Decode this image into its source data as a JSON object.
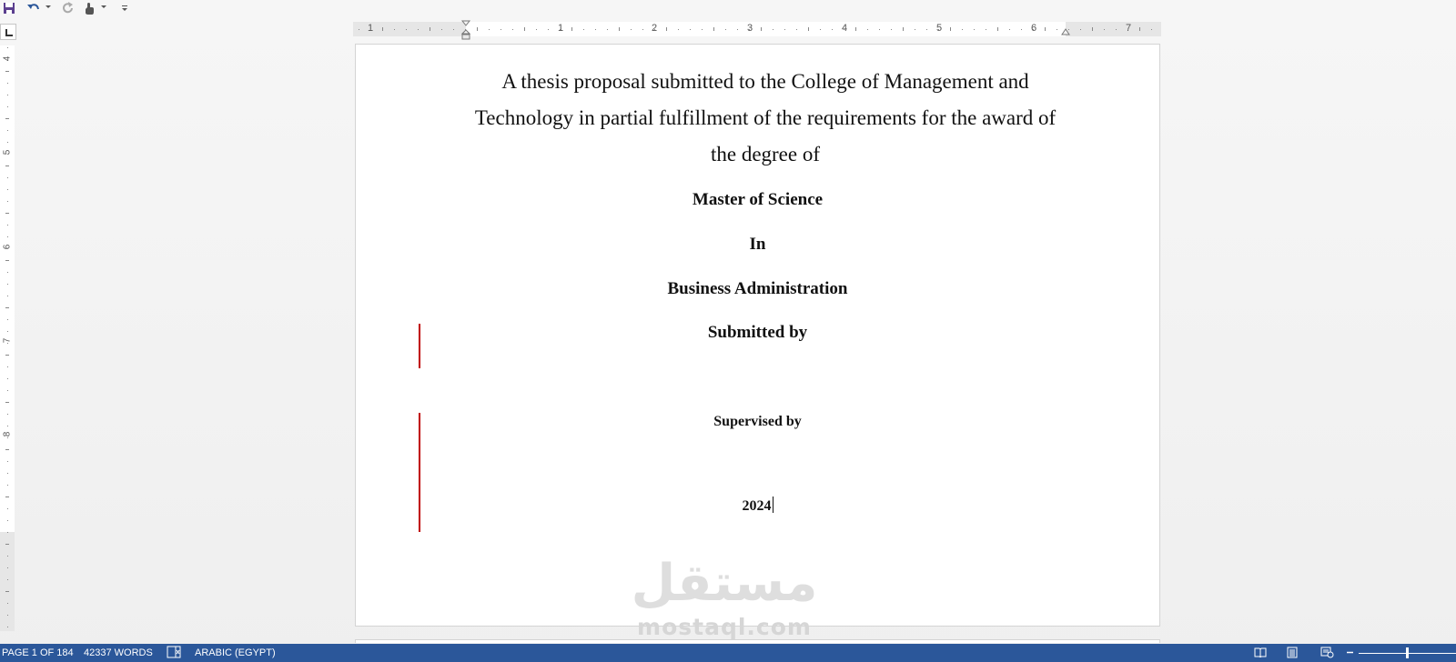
{
  "toolbar": {
    "save_icon": "save-icon",
    "undo_icon": "undo-icon",
    "redo_icon": "redo-icon",
    "touch_mode_icon": "touch-mode-icon",
    "customize_icon": "customize-toolbar-icon"
  },
  "ruler": {
    "horizontal_numbers": [
      "1",
      "1",
      "2",
      "3",
      "4",
      "5",
      "6",
      "7"
    ],
    "vertical_numbers": [
      "4",
      "5",
      "6",
      "7",
      "8"
    ]
  },
  "document": {
    "intro_line_1": "A thesis proposal submitted to the College of Management and",
    "intro_line_2": "Technology in partial fulfillment of the requirements for the award of",
    "intro_line_3": "the degree of",
    "degree": "Master of Science",
    "in": "In",
    "field": "Business Administration",
    "submitted_by": "Submitted by",
    "supervised_by": "Supervised by",
    "year": "2024"
  },
  "watermark": {
    "arabic": "مستقل",
    "latin": "mostaql.com"
  },
  "statusbar": {
    "page": "PAGE 1 OF 184",
    "words": "42337 WORDS",
    "language": "ARABIC (EGYPT)",
    "proofing_icon": "proofing-icon",
    "view_icons": [
      "read-mode-icon",
      "print-layout-icon",
      "web-layout-icon"
    ],
    "zoom_out_icon": "zoom-out-icon",
    "zoom_level": 0.5
  },
  "colors": {
    "statusbar": "#2b579a",
    "change_bar": "#c00000"
  }
}
